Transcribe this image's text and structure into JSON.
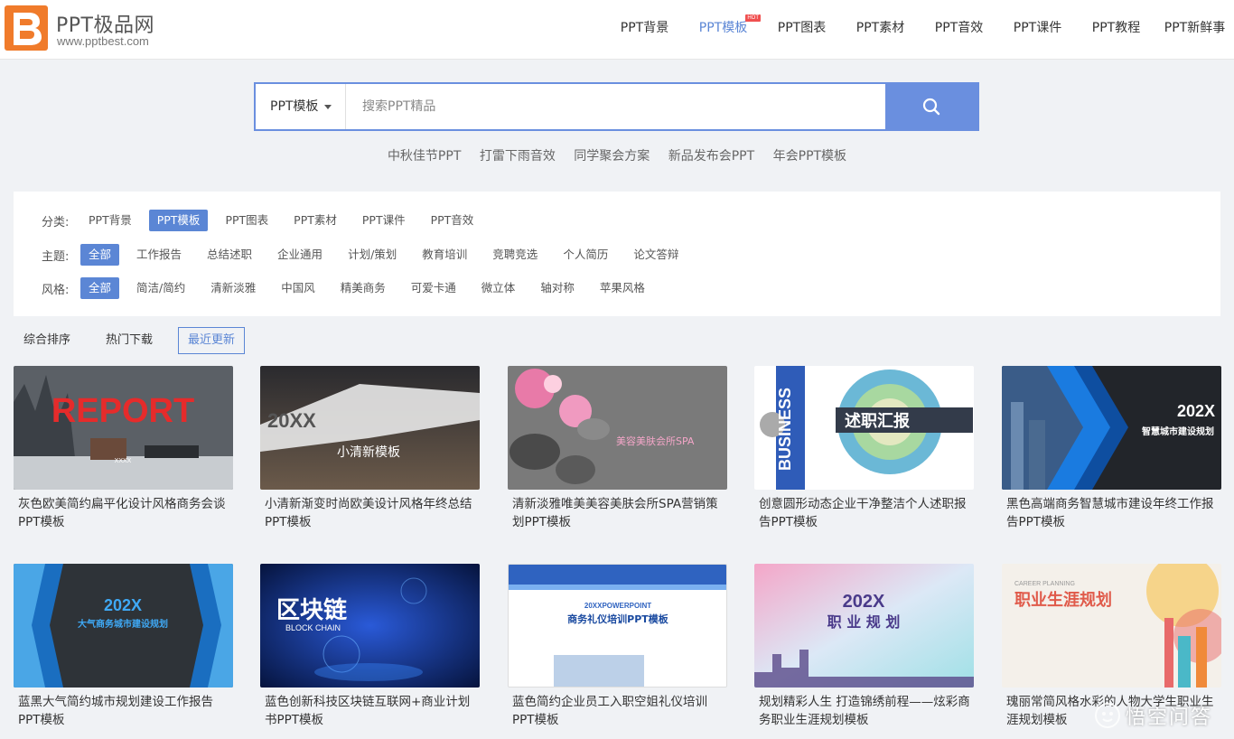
{
  "site": {
    "title": "PPT极品网",
    "url": "www.pptbest.com"
  },
  "nav": [
    {
      "label": "PPT背景",
      "active": false
    },
    {
      "label": "PPT模板",
      "active": true,
      "badge": "HOT"
    },
    {
      "label": "PPT图表",
      "active": false
    },
    {
      "label": "PPT素材",
      "active": false
    },
    {
      "label": "PPT音效",
      "active": false
    },
    {
      "label": "PPT课件",
      "active": false
    },
    {
      "label": "PPT教程",
      "active": false
    },
    {
      "label": "PPT新鲜事",
      "active": false
    }
  ],
  "search": {
    "category": "PPT模板",
    "placeholder": "搜索PPT精品",
    "hot_words": [
      "中秋佳节PPT",
      "打雷下雨音效",
      "同学聚会方案",
      "新品发布会PPT",
      "年会PPT模板"
    ]
  },
  "filters": {
    "category": {
      "label": "分类:",
      "items": [
        "PPT背景",
        "PPT模板",
        "PPT图表",
        "PPT素材",
        "PPT课件",
        "PPT音效"
      ],
      "active": 1
    },
    "theme": {
      "label": "主题:",
      "items": [
        "全部",
        "工作报告",
        "总结述职",
        "企业通用",
        "计划/策划",
        "教育培训",
        "竞聘竞选",
        "个人简历",
        "论文答辩"
      ],
      "active": 0
    },
    "style": {
      "label": "风格:",
      "items": [
        "全部",
        "简洁/简约",
        "清新淡雅",
        "中国风",
        "精美商务",
        "可爱卡通",
        "微立体",
        "轴对称",
        "苹果风格"
      ],
      "active": 0
    }
  },
  "sort": {
    "items": [
      "综合排序",
      "热门下载",
      "最近更新"
    ],
    "active": 2
  },
  "templates": [
    {
      "title": "灰色欧美简约扁平化设计风格商务会谈PPT模板",
      "thumb_text": "REPORT",
      "thumb_sub": "XXXX"
    },
    {
      "title": "小清新渐变时尚欧美设计风格年终总结PPT模板",
      "thumb_text": "20XX",
      "thumb_sub": "小清新模板"
    },
    {
      "title": "清新淡雅唯美美容美肤会所SPA营销策划PPT模板",
      "thumb_text": "美容美肤会所SPA",
      "thumb_sub": ""
    },
    {
      "title": "创意圆形动态企业干净整洁个人述职报告PPT模板",
      "thumb_text": "述职汇报",
      "thumb_sub": "BUSINESS"
    },
    {
      "title": "黑色高端商务智慧城市建设年终工作报告PPT模板",
      "thumb_text": "202X",
      "thumb_sub": "智慧城市建设规划"
    },
    {
      "title": "蓝黑大气简约城市规划建设工作报告PPT模板",
      "thumb_text": "202X",
      "thumb_sub": "大气商务城市建设规划"
    },
    {
      "title": "蓝色创新科技区块链互联网+商业计划书PPT模板",
      "thumb_text": "区块链",
      "thumb_sub": "BLOCK CHAIN"
    },
    {
      "title": "蓝色简约企业员工入职空姐礼仪培训PPT模板",
      "thumb_text": "商务礼仪培训PPT模板",
      "thumb_sub": "20XXPOWERPOINT"
    },
    {
      "title": "规划精彩人生 打造锦绣前程——炫彩商务职业生涯规划模板",
      "thumb_text": "202X",
      "thumb_sub": "职 业 规 划"
    },
    {
      "title": "瑰丽常简风格水彩的人物大学生职业生涯规划模板",
      "thumb_text": "职业生涯规划",
      "thumb_sub": "CAREER PLANNING"
    }
  ],
  "watermark": "悟空问答",
  "colors": {
    "accent": "#5b86d5",
    "search_button": "#6a8fdf",
    "logo_orange": "#f07b2b"
  }
}
